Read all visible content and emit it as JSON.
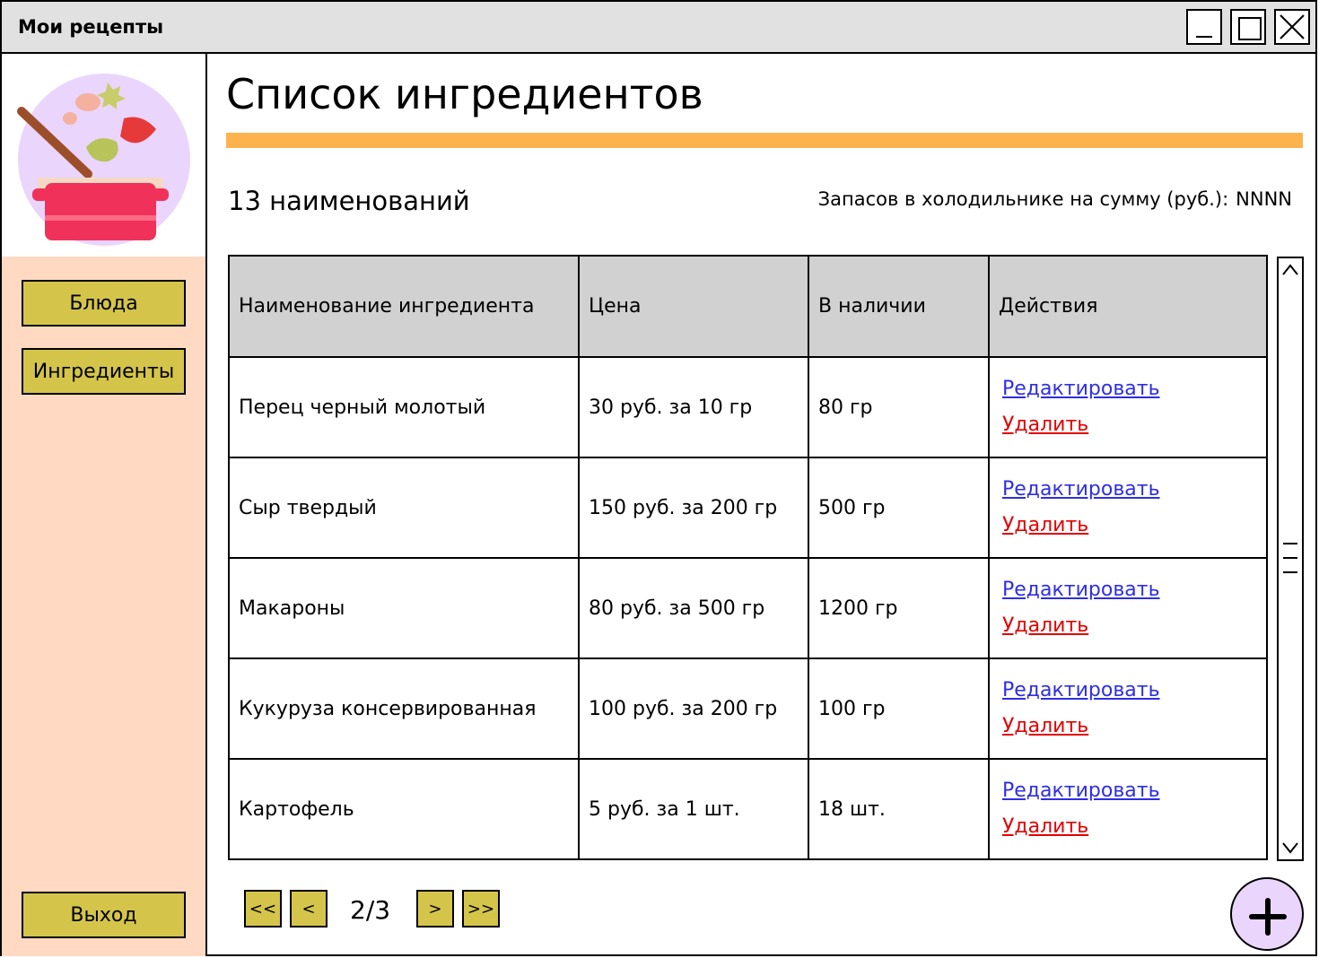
{
  "window": {
    "title": "Мои рецепты",
    "controls": [
      "minimize",
      "maximize",
      "close"
    ]
  },
  "sidebar": {
    "logo_icon": "cooking-pot-icon",
    "nav": {
      "dishes": "Блюда",
      "ingredients": "Ингредиенты",
      "exit": "Выход"
    }
  },
  "main": {
    "title": "Список ингредиентов",
    "count": "13 наименований",
    "stock_sum_label": "Запасов в холодильнике на сумму (руб.):",
    "stock_sum_value": "NNNN",
    "table": {
      "headers": {
        "name": "Наименование ингредиента",
        "price": "Цена",
        "stock": "В наличии",
        "actions": "Действия"
      },
      "rows": [
        {
          "name": "Перец черный молотый",
          "price": "30 руб. за 10 гр",
          "stock": "80 гр",
          "edit": "Редактировать",
          "delete": "Удалить"
        },
        {
          "name": "Сыр твердый",
          "price": "150 руб. за 200 гр",
          "stock": "500 гр",
          "edit": "Редактировать",
          "delete": "Удалить"
        },
        {
          "name": "Макароны",
          "price": "80 руб. за 500 гр",
          "stock": "1200 гр",
          "edit": "Редактировать",
          "delete": "Удалить"
        },
        {
          "name": "Кукуруза консервированная",
          "price": "100 руб. за 200 гр",
          "stock": "100 гр",
          "edit": "Редактировать",
          "delete": "Удалить"
        },
        {
          "name": "Картофель",
          "price": "5 руб. за 1 шт.",
          "stock": "18 шт.",
          "edit": "Редактировать",
          "delete": "Удалить"
        }
      ]
    },
    "pager": {
      "first": "<<",
      "prev": "<",
      "page": "2/3",
      "next": ">",
      "last": ">>"
    },
    "add_icon": "plus-icon"
  },
  "colors": {
    "titlebar": "#e1e1e1",
    "sidebar": "#ffd9c2",
    "button": "#d4c54a",
    "accent_rule": "#fdb34d",
    "table_header": "#d1d1d1",
    "link_edit": "#2e2ee6",
    "link_delete": "#e20000",
    "add_button": "#ead5fc"
  }
}
